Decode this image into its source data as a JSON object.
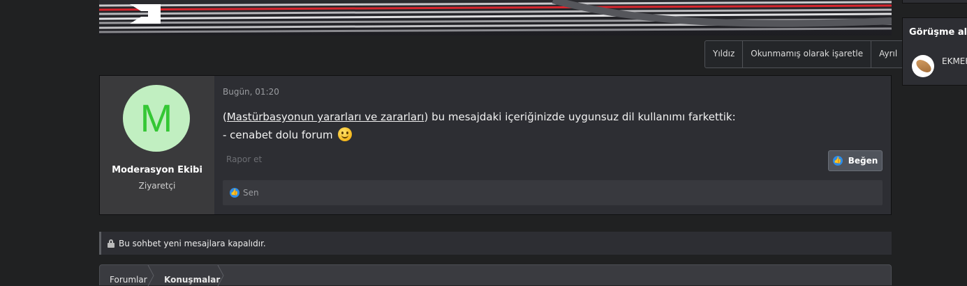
{
  "actions": {
    "star": "Yıldız",
    "mark_unread": "Okunmamış olarak işaretle",
    "leave": "Ayrıl"
  },
  "message": {
    "avatar_letter": "M",
    "username": "Moderasyon Ekibi",
    "user_title": "Ziyaretçi",
    "date": "Bugün, 01:20",
    "link_text": "Mastürbasyonun yararları ve zararları",
    "text_open": "(",
    "text_after_link": ") bu mesajdaki içeriğinizde uygunsuz dil kullanımı farkettik:",
    "line2": "- cenabet dolu forum",
    "report": "Rapor et",
    "like_button": "Beğen",
    "reactions_by": "Sen"
  },
  "notice": {
    "text": "Bu sohbet yeni mesajlara kapalıdır."
  },
  "breadcrumb": [
    "Forumlar",
    "Konuşmalar"
  ],
  "sidebar": {
    "title": "Görüşme alıcı",
    "participant": "EKMEK"
  },
  "colors": {
    "like_blue": "#2d8ce8",
    "avatar_green": "#35c735",
    "avatar_bg": "#c1efc1"
  }
}
